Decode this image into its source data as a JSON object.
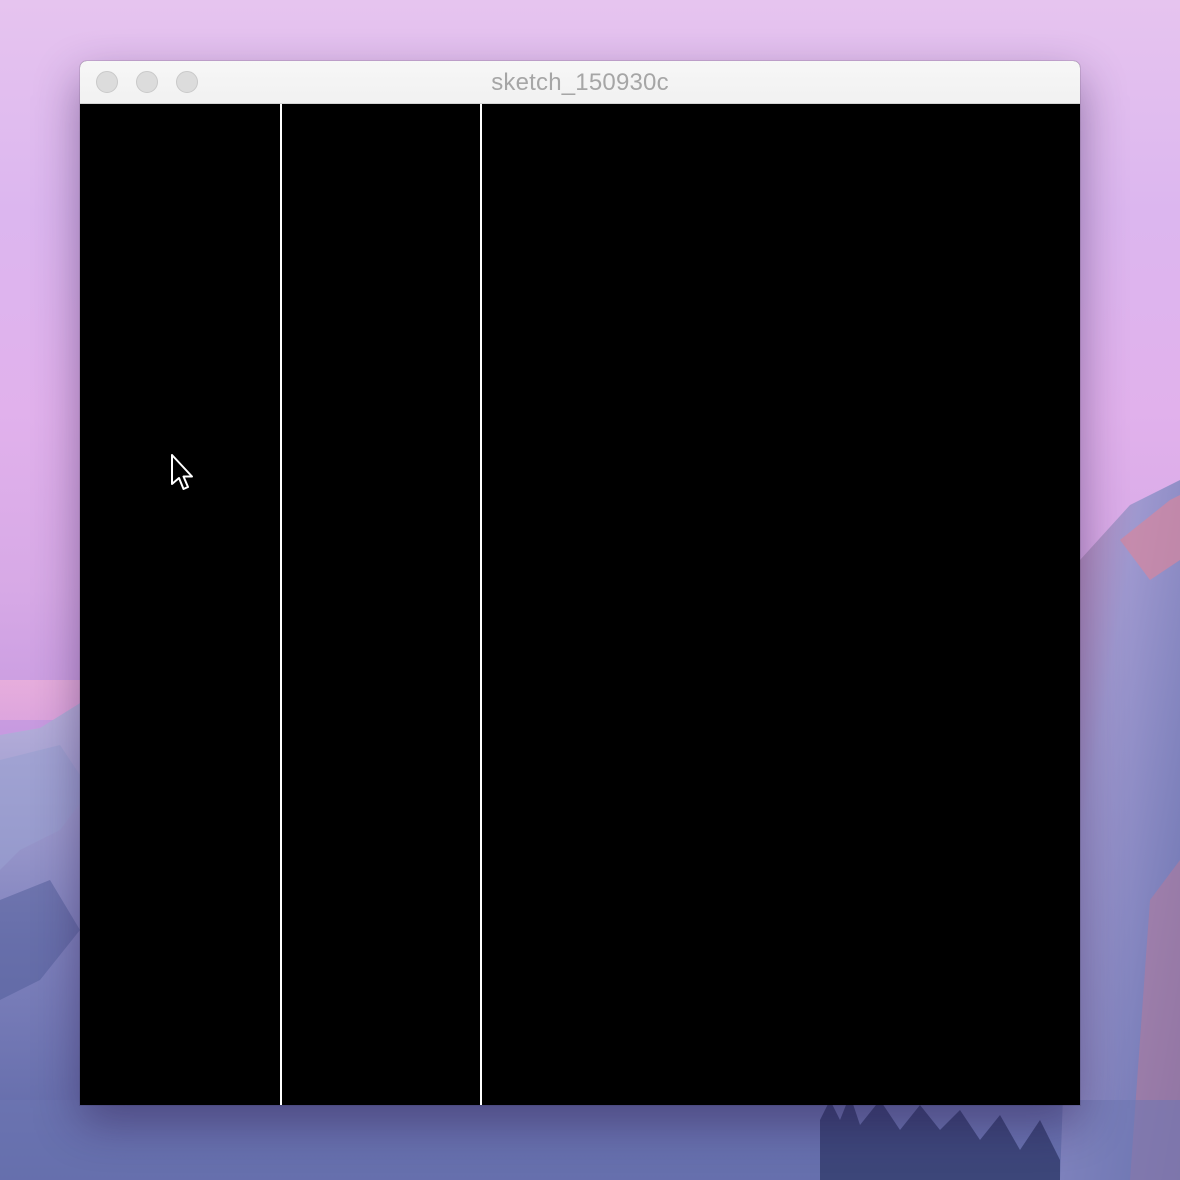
{
  "window": {
    "title": "sketch_150930c"
  },
  "icons": {
    "close": "close-button",
    "minimize": "minimize-button",
    "zoom": "zoom-button",
    "cursor": "mouse-pointer-icon"
  },
  "colors": {
    "canvas_background": "#000000",
    "line_color": "#ffffff",
    "titlebar": "#f4f4f4",
    "title_text": "#a6a6a6",
    "traffic_light_inactive": "#dcdcdc"
  }
}
